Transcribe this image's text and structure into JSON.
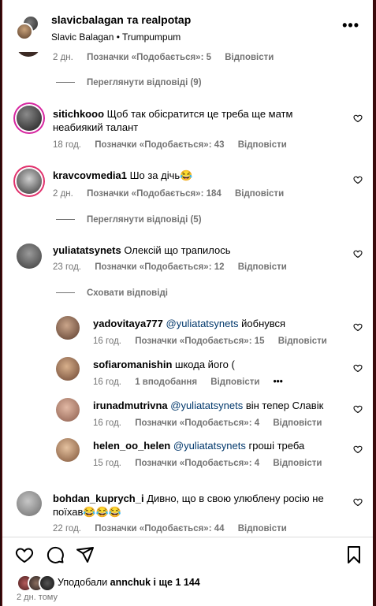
{
  "header": {
    "title": "slavicbalagan та realpotap",
    "subtitle": "Slavic Balagan • Trumpumpum",
    "more_label": "•••"
  },
  "top_partial": {
    "time": "2 дн.",
    "likes": "Позначки «Подобається»: 5",
    "reply": "Відповісти",
    "view_replies": "Переглянути відповіді (9)"
  },
  "comments": [
    {
      "user": "sitichkooo",
      "text": "Щоб так обісратится це треба ще матм",
      "text2": "неабиякий талант",
      "time": "18 год.",
      "likes": "Позначки «Подобається»: 43",
      "reply": "Відповісти"
    },
    {
      "user": "kravcovmedia1",
      "text": "Шо за дічь😂",
      "time": "2 дн.",
      "likes": "Позначки «Подобається»: 184",
      "reply": "Відповісти",
      "view_replies": "Переглянути відповіді (5)"
    },
    {
      "user": "yuliatatsynets",
      "text": "Олексій що трапилось",
      "time": "23 год.",
      "likes": "Позначки «Подобається»: 12",
      "reply": "Відповісти",
      "hide_replies": "Сховати відповіді"
    }
  ],
  "replies": [
    {
      "user": "yadovitaya777",
      "mention": "@yuliatatsynets",
      "text": "йобнувся",
      "time": "16 год.",
      "likes": "Позначки «Подобається»: 15",
      "reply": "Відповісти"
    },
    {
      "user": "sofiaromanishin",
      "mention": "",
      "text": "шкода його (",
      "time": "16 год.",
      "likes": "1 вподобання",
      "reply": "Відповісти",
      "more": "•••"
    },
    {
      "user": "irunadmutrivna",
      "mention": "@yuliatatsynets",
      "text": "він тепер Славік",
      "time": "16 год.",
      "likes": "Позначки «Подобається»: 4",
      "reply": "Відповісти"
    },
    {
      "user": "helen_oo_helen",
      "mention": "@yuliatatsynets",
      "text": "гроші треба",
      "time": "15 год.",
      "likes": "Позначки «Подобається»: 4",
      "reply": "Відповісти"
    }
  ],
  "last_comment": {
    "user": "bohdan_kuprych_i",
    "text": "Дивно, що в свою улюблену росію не",
    "text2": "поїхав😂😂😂",
    "time": "22 год.",
    "likes": "Позначки «Подобається»: 44",
    "reply": "Відповісти"
  },
  "footer": {
    "liked_prefix": "Уподобали",
    "liked_user": "annchuk",
    "liked_suffix": "і ще 1 144",
    "ago": "2 дн. тому"
  }
}
